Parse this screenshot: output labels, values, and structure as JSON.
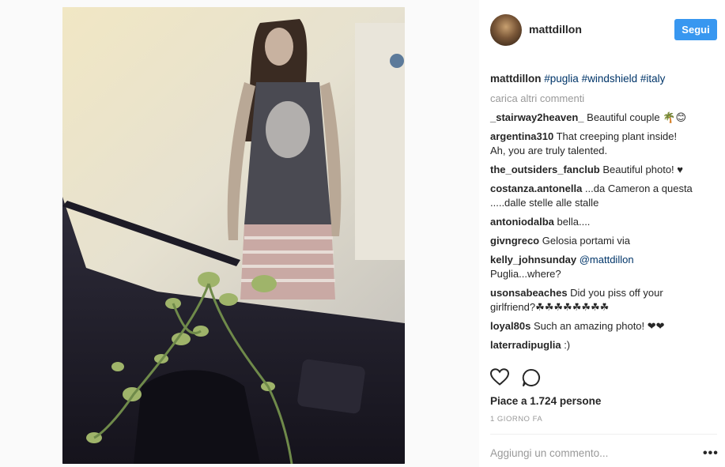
{
  "post": {
    "username": "mattdillon",
    "follow_label": "Segui",
    "caption_user": "mattdillon",
    "caption_tags": [
      "#puglia",
      "#windshield",
      "#italy"
    ],
    "load_more": "carica altri commenti",
    "comments": [
      {
        "user": "_stairway2heaven_",
        "text": " Beautiful couple 🌴😊"
      },
      {
        "user": "argentina310",
        "text": " That creeping plant inside!",
        "text2": "Ah, you are truly talented."
      },
      {
        "user": "the_outsiders_fanclub",
        "text": " Beautiful photo! ♥"
      },
      {
        "user": "costanza.antonella",
        "text": " ...da Cameron a questa",
        "text2": ".....dalle stelle alle stalle"
      },
      {
        "user": "antoniodalba",
        "text": " bella...."
      },
      {
        "user": "givngreco",
        "text": " Gelosia portami via"
      },
      {
        "user": "kelly_johnsunday",
        "mention": "@mattdillon",
        "text2": "Puglia...where?"
      },
      {
        "user": "usonsabeaches",
        "text": " Did you piss off your",
        "text2": "girlfriend?☘☘☘☘☘☘☘☘"
      },
      {
        "user": "loyal80s",
        "text": " Such an amazing photo! ❤❤"
      },
      {
        "user": "laterradipuglia",
        "text": " :)"
      }
    ],
    "likes_text": "Piace a 1.724 persone",
    "time_ago": "1 GIORNO FA",
    "add_comment_placeholder": "Aggiungi un commento...",
    "more_label": "•••",
    "icons": {
      "like": "heart-icon",
      "comment": "comment-icon"
    },
    "colors": {
      "accent": "#3897f0",
      "link": "#003569",
      "muted": "#999999"
    }
  }
}
